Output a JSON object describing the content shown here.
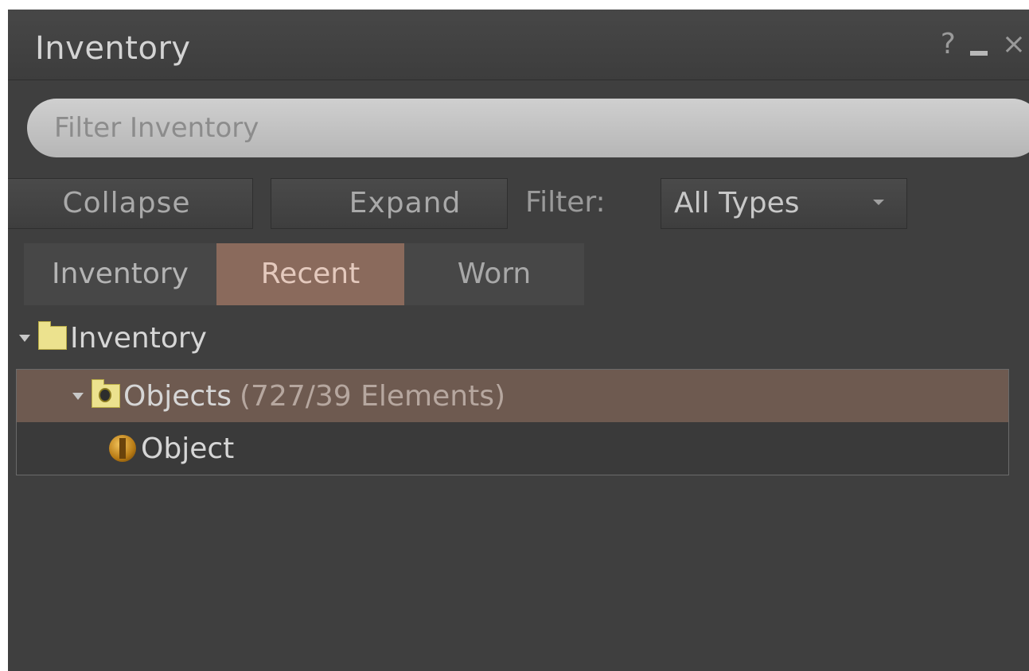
{
  "window": {
    "title": "Inventory",
    "controls": {
      "help": "?",
      "close": "×"
    }
  },
  "search": {
    "placeholder": "Filter Inventory",
    "value": ""
  },
  "toolbar": {
    "collapse_label": "Collapse",
    "expand_label": "Expand",
    "filter_label": "Filter:",
    "filter_select": {
      "value": "All Types"
    }
  },
  "tabs": [
    {
      "label": "Inventory",
      "active": false
    },
    {
      "label": "Recent",
      "active": true
    },
    {
      "label": "Worn",
      "active": false
    }
  ],
  "tree": {
    "root_label": "Inventory",
    "items": [
      {
        "label": "Objects",
        "count_text": "(727/39 Elements)",
        "selected": true
      },
      {
        "label": "Object",
        "selected": false
      }
    ]
  },
  "colors": {
    "window_bg": "#3f3f3f",
    "active_tab": "#8a6a5c",
    "selected_row": "#6e5a50",
    "folder": "#ece28e"
  },
  "icons": [
    "help-icon",
    "minimize-icon",
    "close-icon",
    "dropdown-caret-icon",
    "disclosure-triangle-icon",
    "folder-icon",
    "objects-folder-icon",
    "object-icon"
  ]
}
